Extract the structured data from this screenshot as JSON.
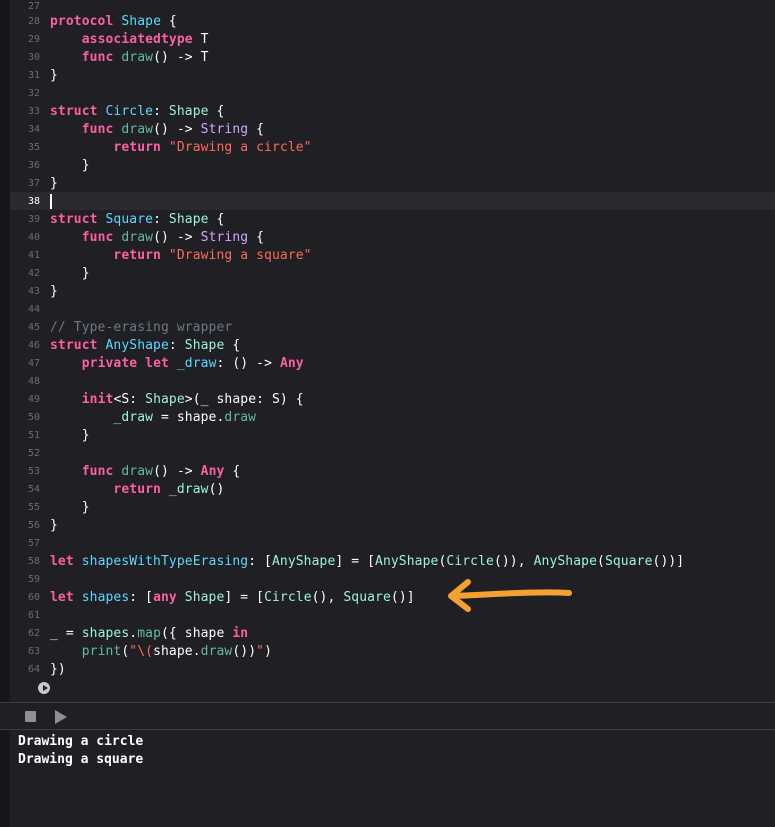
{
  "editor": {
    "line_numbers": [
      "27",
      "28",
      "29",
      "30",
      "31",
      "32",
      "33",
      "34",
      "35",
      "36",
      "37",
      "38",
      "39",
      "40",
      "41",
      "42",
      "43",
      "44",
      "45",
      "46",
      "47",
      "48",
      "49",
      "50",
      "51",
      "52",
      "53",
      "54",
      "55",
      "56",
      "57",
      "58",
      "59",
      "60",
      "61",
      "62",
      "63",
      "64"
    ],
    "current_line": "38",
    "code": {
      "l28": [
        "protocol",
        " ",
        "Shape",
        " {"
      ],
      "l29": [
        "    ",
        "associatedtype",
        " T"
      ],
      "l30": [
        "    ",
        "func",
        " ",
        "draw",
        "() -> T"
      ],
      "l31": [
        "}"
      ],
      "l33": [
        "struct",
        " ",
        "Circle",
        ": ",
        "Shape",
        " {"
      ],
      "l34": [
        "    ",
        "func",
        " ",
        "draw",
        "() -> ",
        "String",
        " {"
      ],
      "l35": [
        "        ",
        "return",
        " ",
        "\"Drawing a circle\""
      ],
      "l36": [
        "    }"
      ],
      "l37": [
        "}"
      ],
      "l39": [
        "struct",
        " ",
        "Square",
        ": ",
        "Shape",
        " {"
      ],
      "l40": [
        "    ",
        "func",
        " ",
        "draw",
        "() -> ",
        "String",
        " {"
      ],
      "l41": [
        "        ",
        "return",
        " ",
        "\"Drawing a square\""
      ],
      "l42": [
        "    }"
      ],
      "l43": [
        "}"
      ],
      "l45": [
        "// Type-erasing wrapper"
      ],
      "l46": [
        "struct",
        " ",
        "AnyShape",
        ": ",
        "Shape",
        " {"
      ],
      "l47": [
        "    ",
        "private",
        " ",
        "let",
        " ",
        "_draw",
        ": () -> ",
        "Any"
      ],
      "l49": [
        "    ",
        "init",
        "<S: ",
        "Shape",
        ">(_ shape: S) {"
      ],
      "l50": [
        "        ",
        "_draw",
        " = shape.",
        "draw"
      ],
      "l51": [
        "    }"
      ],
      "l53": [
        "    ",
        "func",
        " ",
        "draw",
        "() -> ",
        "Any",
        " {"
      ],
      "l54": [
        "        ",
        "return",
        " ",
        "_draw",
        "()"
      ],
      "l55": [
        "    }"
      ],
      "l56": [
        "}"
      ],
      "l58": [
        "let",
        " ",
        "shapesWithTypeErasing",
        ": [",
        "AnyShape",
        "] = [",
        "AnyShape",
        "(",
        "Circle",
        "()), ",
        "AnyShape",
        "(",
        "Square",
        "())]"
      ],
      "l60": [
        "let",
        " ",
        "shapes",
        ": [",
        "any",
        " ",
        "Shape",
        "] = [",
        "Circle",
        "(), ",
        "Square",
        "()]"
      ],
      "l62": [
        "_ = ",
        "shapes",
        ".",
        "map",
        "({ shape ",
        "in"
      ],
      "l63": [
        "    ",
        "print",
        "(",
        "\"\\(",
        "shape.",
        "draw",
        "())",
        "\"",
        ")"
      ],
      "l64": [
        "})"
      ]
    }
  },
  "console": {
    "output": [
      "Drawing a circle",
      "Drawing a square"
    ]
  },
  "colors": {
    "keyword": "#fc5fa3",
    "type": "#5dd8ff",
    "type_ref": "#9ef1dd",
    "function": "#67b7a4",
    "string": "#fc6a5d",
    "comment": "#6c7986",
    "arrow": "#f5a030"
  },
  "icons": [
    "run-gutter-icon",
    "stop-icon",
    "play-icon",
    "annotation-arrow"
  ]
}
